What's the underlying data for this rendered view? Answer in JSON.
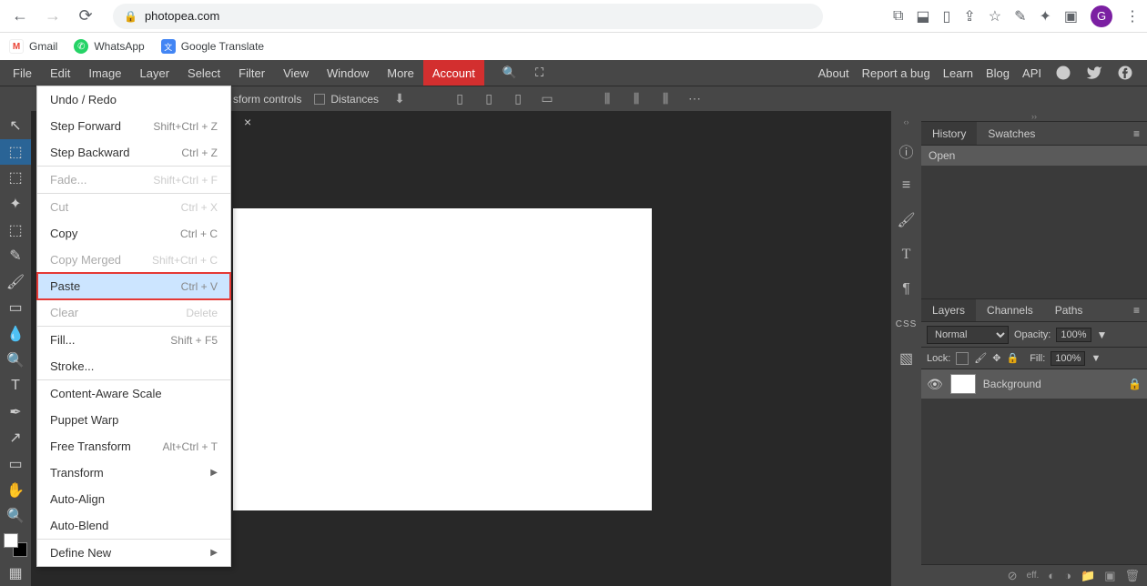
{
  "browser": {
    "url": "photopea.com",
    "avatar_initial": "G"
  },
  "bookmarks": [
    {
      "label": "Gmail",
      "color": "#ea4335"
    },
    {
      "label": "WhatsApp",
      "color": "#25d366"
    },
    {
      "label": "Google Translate",
      "color": "#4285f4"
    }
  ],
  "menubar": {
    "items": [
      "File",
      "Edit",
      "Image",
      "Layer",
      "Select",
      "Filter",
      "View",
      "Window",
      "More"
    ],
    "account": "Account",
    "right": [
      "About",
      "Report a bug",
      "Learn",
      "Blog",
      "API"
    ]
  },
  "options_bar": {
    "transform": "sform controls",
    "distances": "Distances"
  },
  "edit_menu": [
    {
      "label": "Undo / Redo",
      "shortcut": "",
      "enabled": true
    },
    {
      "label": "Step Forward",
      "shortcut": "Shift+Ctrl + Z",
      "enabled": true
    },
    {
      "label": "Step Backward",
      "shortcut": "Ctrl + Z",
      "enabled": true
    },
    {
      "sep": true
    },
    {
      "label": "Fade...",
      "shortcut": "Shift+Ctrl + F",
      "enabled": false
    },
    {
      "sep": true
    },
    {
      "label": "Cut",
      "shortcut": "Ctrl + X",
      "enabled": false
    },
    {
      "label": "Copy",
      "shortcut": "Ctrl + C",
      "enabled": true
    },
    {
      "label": "Copy Merged",
      "shortcut": "Shift+Ctrl + C",
      "enabled": false
    },
    {
      "label": "Paste",
      "shortcut": "Ctrl + V",
      "enabled": true,
      "highlighted": true
    },
    {
      "label": "Clear",
      "shortcut": "Delete",
      "enabled": false
    },
    {
      "sep": true
    },
    {
      "label": "Fill...",
      "shortcut": "Shift + F5",
      "enabled": true
    },
    {
      "label": "Stroke...",
      "shortcut": "",
      "enabled": true
    },
    {
      "sep": true
    },
    {
      "label": "Content-Aware Scale",
      "shortcut": "",
      "enabled": true
    },
    {
      "label": "Puppet Warp",
      "shortcut": "",
      "enabled": true
    },
    {
      "label": "Free Transform",
      "shortcut": "Alt+Ctrl + T",
      "enabled": true
    },
    {
      "label": "Transform",
      "shortcut": "",
      "enabled": true,
      "submenu": true
    },
    {
      "label": "Auto-Align",
      "shortcut": "",
      "enabled": true
    },
    {
      "label": "Auto-Blend",
      "shortcut": "",
      "enabled": true
    },
    {
      "sep": true
    },
    {
      "label": "Define New",
      "shortcut": "",
      "enabled": true,
      "submenu": true
    }
  ],
  "history_panel": {
    "tabs": [
      "History",
      "Swatches"
    ],
    "entry": "Open"
  },
  "layers_panel": {
    "tabs": [
      "Layers",
      "Channels",
      "Paths"
    ],
    "blend_mode": "Normal",
    "opacity_label": "Opacity:",
    "opacity_value": "100%",
    "lock_label": "Lock:",
    "fill_label": "Fill:",
    "fill_value": "100%",
    "layer_name": "Background"
  },
  "right_strip": {
    "css_label": "CSS"
  }
}
